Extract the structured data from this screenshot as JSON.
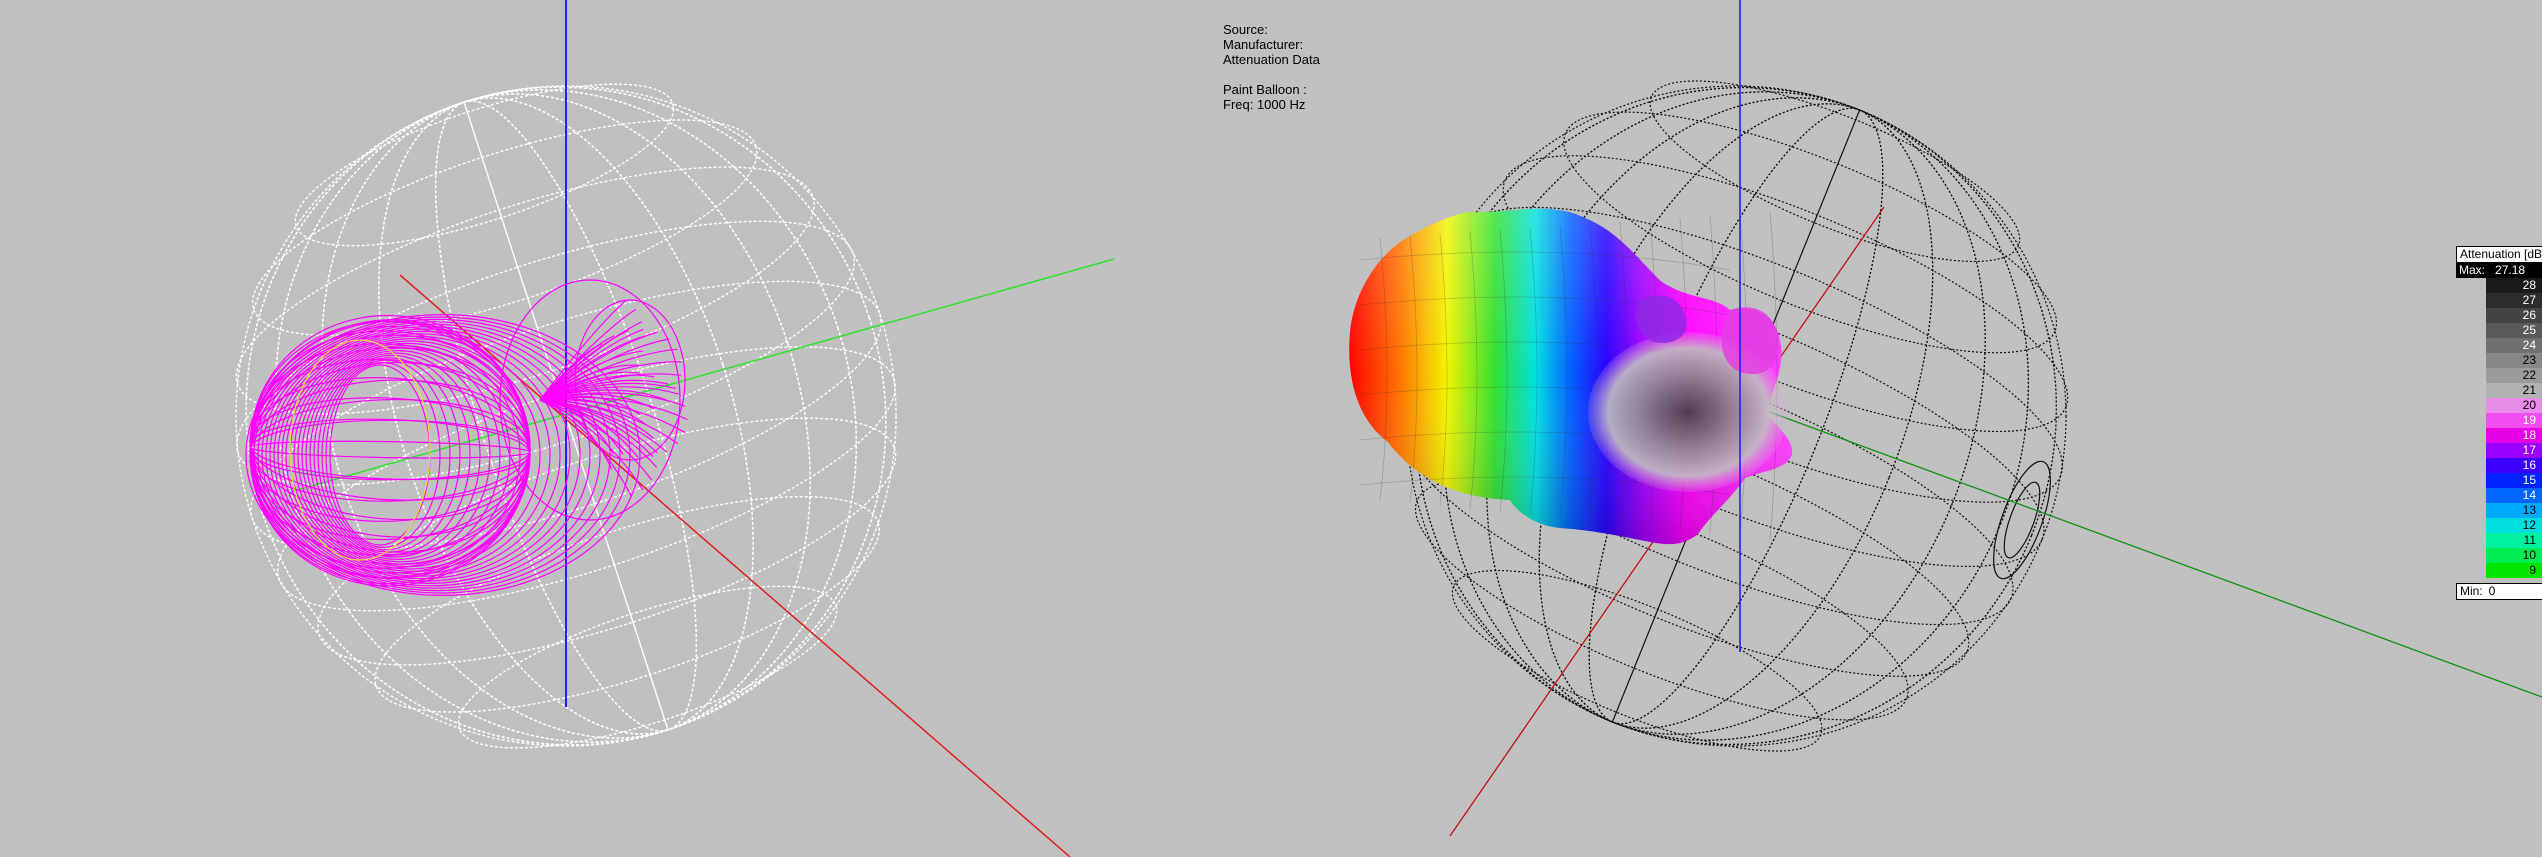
{
  "info_panel": {
    "source_label": "Source:",
    "manufacturer_label": "Manufacturer:",
    "attenuation_label": "Attenuation Data",
    "paint_balloon_label": "Paint Balloon :",
    "freq_label": "Freq: 1000 Hz"
  },
  "legend": {
    "title": "Attenuation [dB]",
    "max_label": "Max:",
    "max_value": "27.18",
    "min_label": "Min:",
    "min_value": "0",
    "levels": [
      {
        "value": "28",
        "color": "#1a1a1a",
        "text": "#ffffff"
      },
      {
        "value": "27",
        "color": "#2c2c2c",
        "text": "#ffffff"
      },
      {
        "value": "26",
        "color": "#444444",
        "text": "#ffffff"
      },
      {
        "value": "25",
        "color": "#5a5a5a",
        "text": "#ffffff"
      },
      {
        "value": "24",
        "color": "#707070",
        "text": "#ffffff"
      },
      {
        "value": "23",
        "color": "#878787",
        "text": "#000000"
      },
      {
        "value": "22",
        "color": "#9c9c9c",
        "text": "#000000"
      },
      {
        "value": "21",
        "color": "#b2b2b2",
        "text": "#000000"
      },
      {
        "value": "20",
        "color": "#e98be9",
        "text": "#000000"
      },
      {
        "value": "19",
        "color": "#f04cf0",
        "text": "#ffffff"
      },
      {
        "value": "18",
        "color": "#e600e6",
        "text": "#ffffff"
      },
      {
        "value": "17",
        "color": "#9900ff",
        "text": "#ffffff"
      },
      {
        "value": "16",
        "color": "#3c00ff",
        "text": "#ffffff"
      },
      {
        "value": "15",
        "color": "#0022ff",
        "text": "#ffffff"
      },
      {
        "value": "14",
        "color": "#0066ff",
        "text": "#ffffff"
      },
      {
        "value": "13",
        "color": "#00aaff",
        "text": "#000000"
      },
      {
        "value": "12",
        "color": "#00dddd",
        "text": "#000000"
      },
      {
        "value": "11",
        "color": "#00f0a0",
        "text": "#000000"
      },
      {
        "value": "10",
        "color": "#00ee55",
        "text": "#000000"
      },
      {
        "value": "9",
        "color": "#00e600",
        "text": "#000000"
      }
    ]
  },
  "colors": {
    "background": "#c0c0c0",
    "x_axis": "#e02020",
    "y_axis": "#2020ff",
    "z_axis": "#20e020",
    "wireframe_balloon": "#ff00ff",
    "left_sphere": "#ffffff",
    "right_sphere": "#000000"
  }
}
